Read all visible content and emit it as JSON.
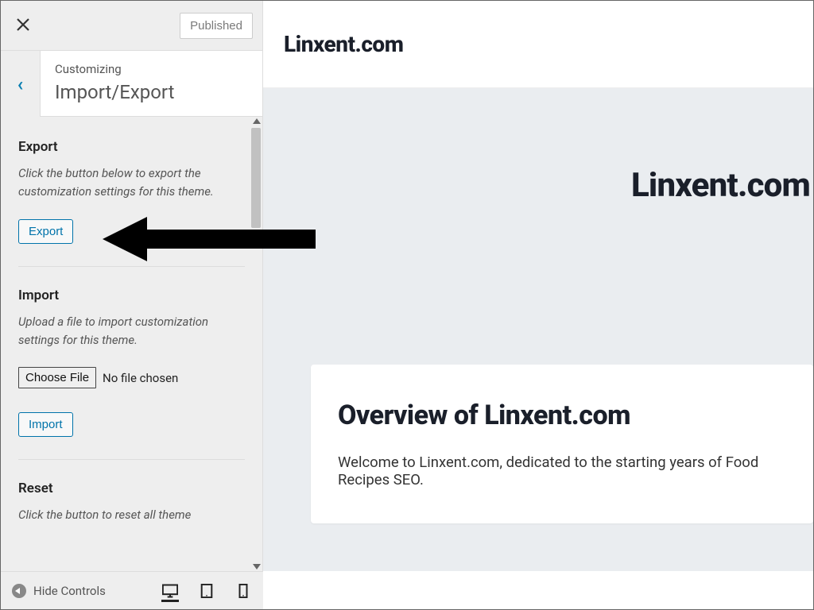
{
  "topbar": {
    "published_label": "Published"
  },
  "title_card": {
    "eyebrow": "Customizing",
    "title": "Import/Export"
  },
  "export": {
    "heading": "Export",
    "description": "Click the button below to export the customization settings for this theme.",
    "button_label": "Export"
  },
  "import": {
    "heading": "Import",
    "description": "Upload a file to import customization settings for this theme.",
    "choose_file_label": "Choose File",
    "no_file_label": "No file chosen",
    "button_label": "Import"
  },
  "reset": {
    "heading": "Reset",
    "description": "Click the button to reset all theme"
  },
  "bottombar": {
    "hide_controls": "Hide Controls"
  },
  "preview": {
    "site_title": "Linxent.com",
    "card_title": "Overview of Linxent.com",
    "card_body": "Welcome to Linxent.com, dedicated to the starting years of Food Recipes SEO."
  }
}
